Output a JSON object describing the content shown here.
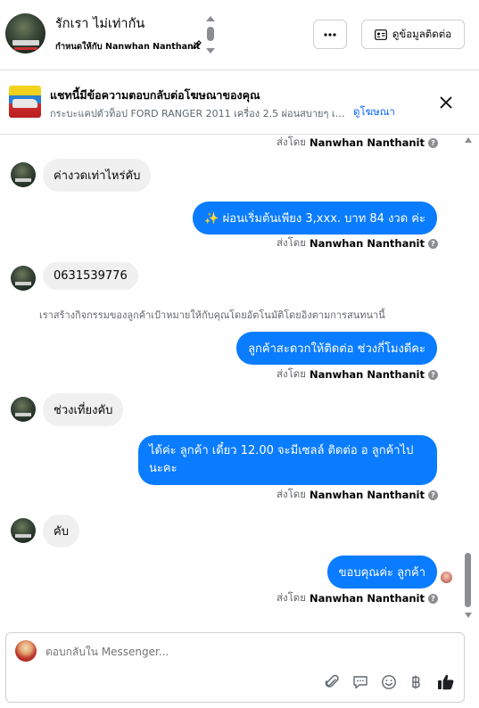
{
  "header": {
    "contact_name": "รักเรา ไม่เท่ากัน",
    "assigned_text": "กำหนดให้กับ Nanwhan Nanthanit",
    "contact_info_label": "ดูข้อมูลติดต่อ"
  },
  "ad_banner": {
    "title": "แชทนี้มีข้อความตอบกลับต่อโฆษณาของคุณ",
    "description": "กระบะแคปตัวท็อป FORD RANGER 2011 เครื่อง 2.5 ผ่อนสบายๆ เริ่มต้นเพีย...",
    "view_ad_label": "ดูโฆษณา"
  },
  "sent_by_prefix": "ส่งโดย",
  "agent_name": "Nanwhan Nanthanit",
  "messages": [
    {
      "text": "ค่างวดเท่าไหร่คับ"
    },
    {
      "text": "✨ ผ่อนเริ่มต้นเพียง 3,xxx. บาท 84 งวด ค่ะ"
    },
    {
      "text": "0631539776"
    },
    {
      "text": "เราสร้างกิจกรรมของลูกค้าเป้าหมายให้กับคุณโดยอัตโนมัติโดยอิงตามการสนทนานี้"
    },
    {
      "text": "ลูกค้าสะดวกให้ติดต่อ ช่วงกี่โมงดีคะ"
    },
    {
      "text": "ช่วงเที่ยงคับ"
    },
    {
      "text": "ได้ค่ะ ลูกค้า เดี๋ยว 12.00 จะมีเซลล์ ติดต่อ อ ลูกค้าไปนะคะ"
    },
    {
      "text": "คับ"
    },
    {
      "text": "ขอบคุณค่ะ ลูกค้า"
    }
  ],
  "composer": {
    "placeholder": "ตอบกลับใน Messenger..."
  },
  "colors": {
    "outgoing_bubble": "#0a7cff",
    "incoming_bubble": "#f0f0f0",
    "link": "#0866ff"
  }
}
